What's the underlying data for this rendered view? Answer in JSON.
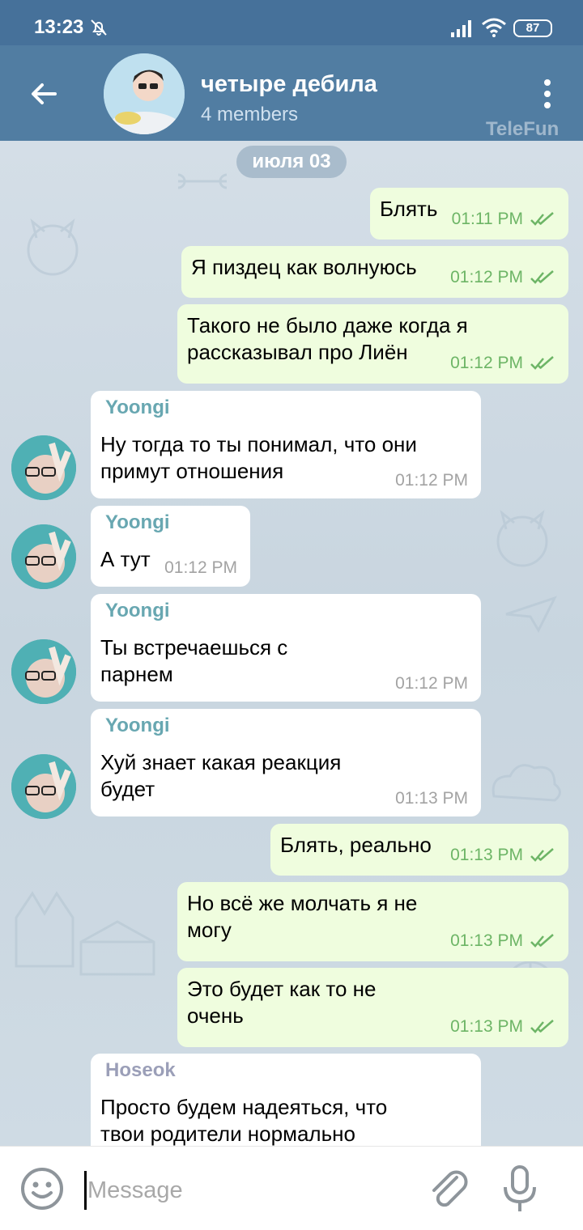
{
  "status_bar": {
    "time": "13:23",
    "battery": "87"
  },
  "header": {
    "title": "четыре дебила",
    "subtitle": "4 members",
    "watermark": "TeleFun"
  },
  "chat": {
    "date": "июля 03",
    "messages": [
      {
        "dir": "out",
        "text": "Блять",
        "time": "01:11 PM"
      },
      {
        "dir": "out",
        "text": "Я пиздец как волнуюсь",
        "time": "01:12 PM"
      },
      {
        "dir": "out",
        "text_lines": [
          "Такого не было даже когда я",
          "рассказывал про Лиён"
        ],
        "time": "01:12 PM"
      },
      {
        "dir": "in",
        "sender": "Yoongi",
        "text_lines": [
          "Ну тогда то ты понимал, что они",
          "примут отношения"
        ],
        "time": "01:12 PM"
      },
      {
        "dir": "in",
        "sender": "Yoongi",
        "text": "А тут",
        "time": "01:12 PM"
      },
      {
        "dir": "in",
        "sender": "Yoongi",
        "text_lines": [
          "Ты встречаешься с",
          "парнем"
        ],
        "time": "01:12 PM"
      },
      {
        "dir": "in",
        "sender": "Yoongi",
        "text_lines": [
          "Хуй знает какая реакция",
          "будет"
        ],
        "time": "01:13 PM"
      },
      {
        "dir": "out",
        "text": "Блять, реально",
        "time": "01:13 PM"
      },
      {
        "dir": "out",
        "text_lines": [
          "Но всё же молчать я не",
          "могу"
        ],
        "time": "01:13 PM"
      },
      {
        "dir": "out",
        "text_lines": [
          "Это будет как то не",
          "очень"
        ],
        "time": "01:13 PM"
      },
      {
        "dir": "in",
        "sender": "Hoseok",
        "text_lines": [
          "Просто будем надеяться, что",
          "твои родители нормально"
        ]
      }
    ]
  },
  "input": {
    "placeholder": "Message"
  },
  "colors": {
    "header": "#517da2",
    "status_bar": "#46719a",
    "outgoing_bubble": "#effdde",
    "incoming_bubble": "#ffffff",
    "time_outgoing": "#6db566",
    "sender_yoongi": "#68a7b1",
    "sender_hoseok": "#9b9fb8"
  },
  "icons": [
    "back-arrow-icon",
    "more-vertical-icon",
    "bell-off-icon",
    "signal-icon",
    "wifi-icon",
    "double-check-icon",
    "emoji-icon",
    "paperclip-icon",
    "microphone-icon"
  ]
}
